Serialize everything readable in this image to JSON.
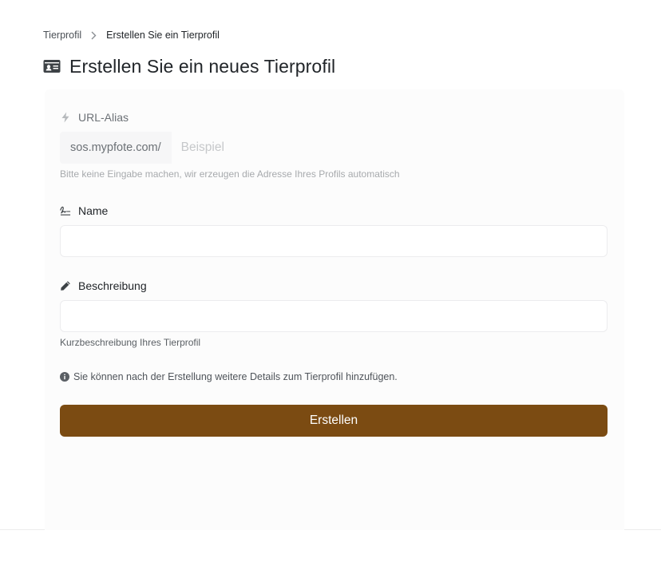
{
  "breadcrumb": {
    "parent": "Tierprofil",
    "current": "Erstellen Sie ein Tierprofil"
  },
  "page": {
    "title": "Erstellen Sie ein neues Tierprofil",
    "title_icon": "id-card-icon"
  },
  "form": {
    "alias": {
      "label": "URL-Alias",
      "icon": "bolt-icon",
      "prefix": "sos.mypfote.com/",
      "value": "",
      "placeholder": "Beispiel",
      "help": "Bitte keine Eingabe machen, wir erzeugen die Adresse Ihres Profils automatisch"
    },
    "name": {
      "label": "Name",
      "icon": "signature-icon",
      "value": "",
      "placeholder": ""
    },
    "description": {
      "label": "Beschreibung",
      "icon": "pencil-icon",
      "value": "",
      "placeholder": "",
      "help": "Kurzbeschreibung Ihres Tierprofil"
    },
    "info": {
      "icon": "info-circle-icon",
      "text": "Sie können nach der Erstellung weitere Details zum Tierprofil hinzufügen."
    },
    "submit_label": "Erstellen"
  },
  "colors": {
    "accent": "#7b4b12",
    "text": "#212529",
    "muted": "#6c7176",
    "help": "#a7aaad"
  }
}
